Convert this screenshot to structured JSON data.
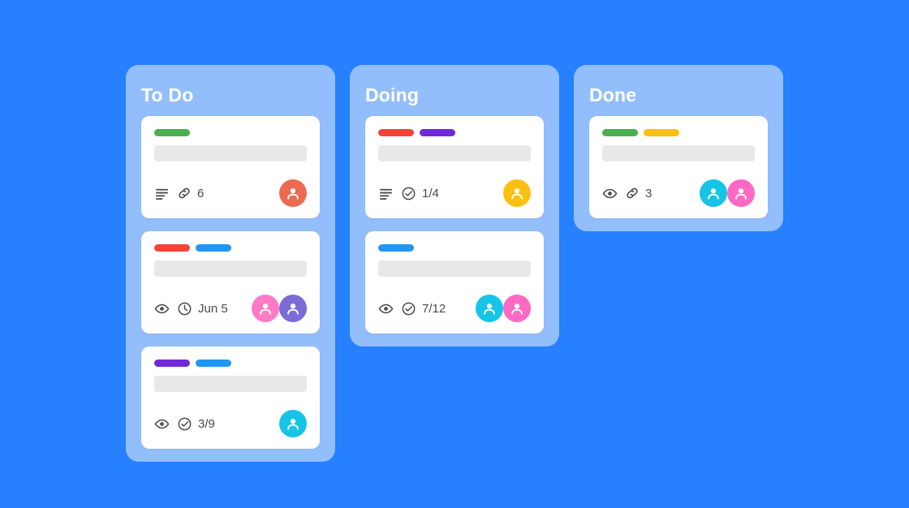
{
  "theme": {
    "page_background": "#2680FF",
    "column_background": "#93BEFC",
    "card_background": "#FFFFFF",
    "placeholder": "#E8E8E8",
    "header_text": "#FFFFFF",
    "meta_text": "#4A4A4A"
  },
  "columns": [
    {
      "title": "To Do",
      "cards": [
        {
          "labels": [
            {
              "color": "#4CAF50"
            }
          ],
          "meta": [
            {
              "icon": "description-icon",
              "text": ""
            },
            {
              "icon": "link-icon",
              "text": "6"
            }
          ],
          "avatars": [
            {
              "color": "#EC6A52",
              "stack": "front"
            }
          ]
        },
        {
          "labels": [
            {
              "color": "#F44336"
            },
            {
              "color": "#2196F3"
            }
          ],
          "meta": [
            {
              "icon": "eye-icon",
              "text": ""
            },
            {
              "icon": "clock-icon",
              "text": "Jun 5"
            }
          ],
          "avatars": [
            {
              "color": "#FF7BC6",
              "stack": "behind"
            },
            {
              "color": "#7C6BD6",
              "stack": "front"
            }
          ]
        },
        {
          "labels": [
            {
              "color": "#7129D6"
            },
            {
              "color": "#2196F3"
            }
          ],
          "meta": [
            {
              "icon": "eye-icon",
              "text": ""
            },
            {
              "icon": "check-circle-icon",
              "text": "3/9"
            }
          ],
          "avatars": [
            {
              "color": "#16C4E8",
              "stack": "front"
            }
          ]
        }
      ]
    },
    {
      "title": "Doing",
      "cards": [
        {
          "labels": [
            {
              "color": "#F44336"
            },
            {
              "color": "#7129D6"
            }
          ],
          "meta": [
            {
              "icon": "description-icon",
              "text": ""
            },
            {
              "icon": "check-circle-icon",
              "text": "1/4"
            }
          ],
          "avatars": [
            {
              "color": "#FCC011",
              "stack": "front"
            }
          ]
        },
        {
          "labels": [
            {
              "color": "#2196F3"
            }
          ],
          "meta": [
            {
              "icon": "eye-icon",
              "text": ""
            },
            {
              "icon": "check-circle-icon",
              "text": "7/12"
            }
          ],
          "avatars": [
            {
              "color": "#16C4E8",
              "stack": "behind"
            },
            {
              "color": "#FF69C4",
              "stack": "front"
            }
          ]
        }
      ]
    },
    {
      "title": "Done",
      "cards": [
        {
          "labels": [
            {
              "color": "#4CAF50"
            },
            {
              "color": "#FCC011"
            }
          ],
          "meta": [
            {
              "icon": "eye-icon",
              "text": ""
            },
            {
              "icon": "link-icon",
              "text": "3"
            }
          ],
          "avatars": [
            {
              "color": "#16C4E8",
              "stack": "behind"
            },
            {
              "color": "#FF69C4",
              "stack": "front"
            }
          ]
        }
      ]
    }
  ]
}
